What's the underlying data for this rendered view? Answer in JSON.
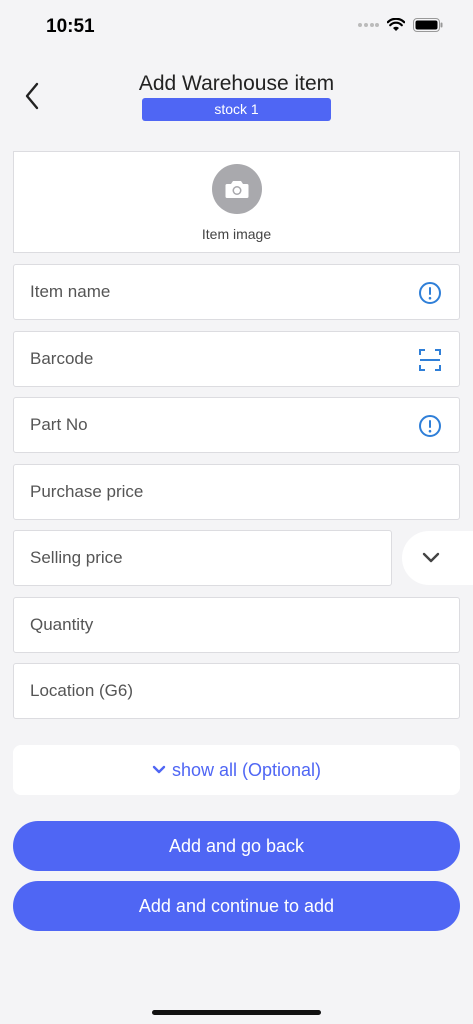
{
  "status_bar": {
    "time": "10:51"
  },
  "header": {
    "title": "Add Warehouse item",
    "badge": "stock 1"
  },
  "image_picker": {
    "label": "Item image"
  },
  "fields": {
    "item_name": {
      "placeholder": "Item name"
    },
    "barcode": {
      "placeholder": "Barcode"
    },
    "part_no": {
      "placeholder": "Part No"
    },
    "purchase_price": {
      "placeholder": "Purchase price"
    },
    "selling_price": {
      "placeholder": "Selling price"
    },
    "quantity": {
      "placeholder": "Quantity"
    },
    "location": {
      "placeholder": "Location (G6)"
    }
  },
  "show_all": {
    "label": "show all (Optional)"
  },
  "actions": {
    "add_go_back": "Add and go back",
    "add_continue": "Add and continue to add"
  },
  "icons": {
    "back": "chevron-left-icon",
    "camera": "camera-icon",
    "info": "info-circle-icon",
    "scan": "barcode-scan-icon",
    "dropdown": "chevron-down-icon"
  },
  "colors": {
    "accent": "#4f66f4",
    "info": "#2f7fd8",
    "background": "#f4f4f6"
  }
}
